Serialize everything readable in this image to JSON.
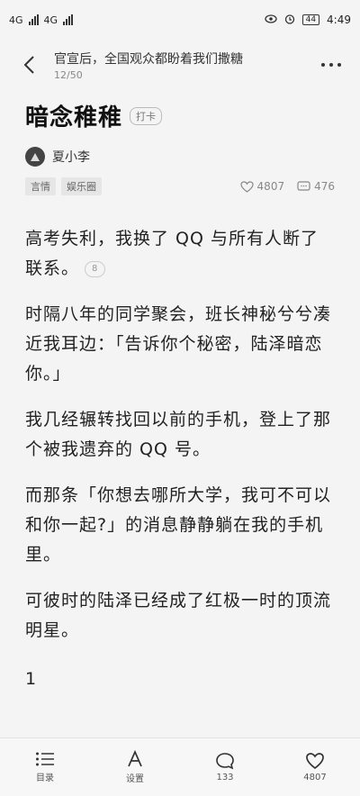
{
  "status_bar": {
    "left": [
      "4G",
      "4G"
    ],
    "battery": "44",
    "time": "4:49"
  },
  "nav": {
    "title": "官宣后，全国观众都盼着我们撒糖",
    "progress": "12/50"
  },
  "story": {
    "title": "暗念稚稚",
    "checkin_label": "打卡",
    "author": "夏小李",
    "tags": [
      "言情",
      "娱乐圈"
    ],
    "likes": "4807",
    "comments": "476"
  },
  "body": {
    "paragraphs": [
      "高考失利，我换了 QQ 与所有人断了联系。",
      "时隔八年的同学聚会，班长神秘兮兮凑近我耳边：「告诉你个秘密，陆泽暗恋你。」",
      "我几经辗转找回以前的手机，登上了那个被我遗弃的 QQ 号。",
      "而那条「你想去哪所大学，我可不可以和你一起?」的消息静静躺在我的手机里。",
      "可彼时的陆泽已经成了红极一时的顶流明星。"
    ],
    "first_para_comment_count": "8",
    "chapter_marker": "1"
  },
  "bottom_bar": {
    "toc": "目录",
    "settings": "设置",
    "comments": "133",
    "likes": "4807"
  }
}
